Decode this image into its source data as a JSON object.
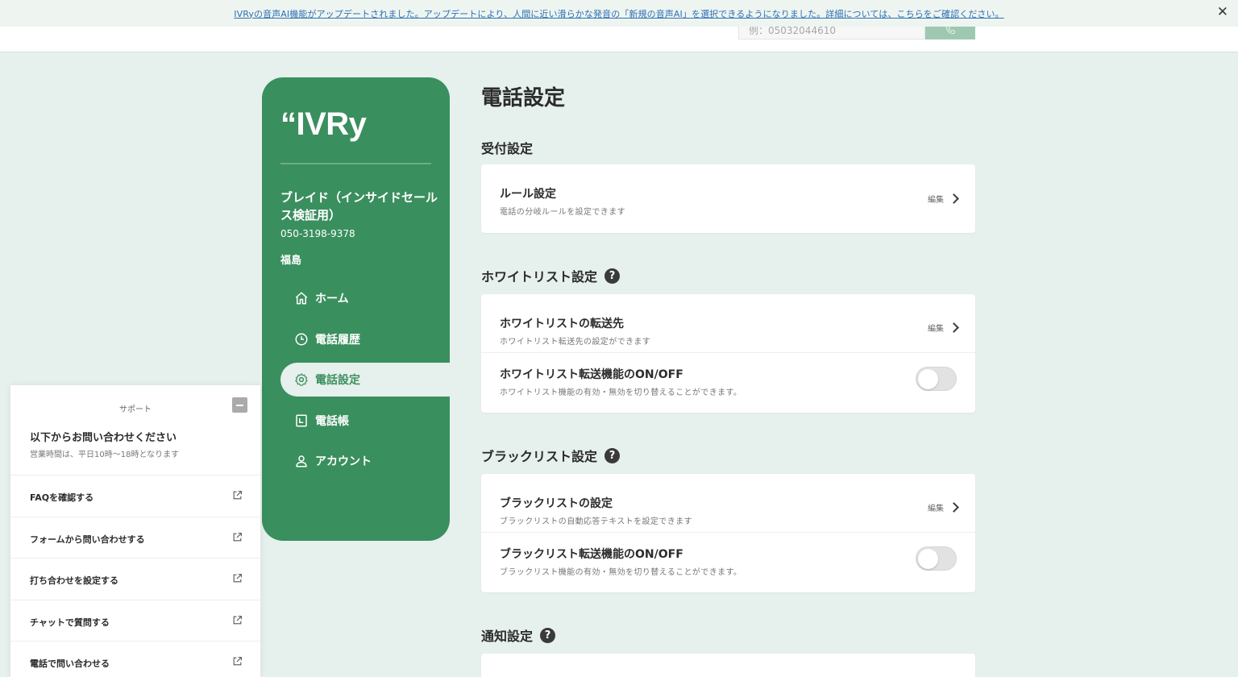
{
  "banner": {
    "text": "IVRyの音声AI機能がアップデートされました。アップデートにより、人間に近い滑らかな発音の「新規の音声AI」を選択できるようになりました。詳細については、こちらをご確認ください。",
    "close": "✕"
  },
  "header": {
    "phone_placeholder": "例：05032044610"
  },
  "sidebar": {
    "logo": "“IVRy",
    "company_name": "ブレイド（インサイドセールス検証用）",
    "company_phone": "050-3198-9378",
    "user_name": "福島",
    "nav": [
      {
        "label": "ホーム",
        "icon": "home-icon"
      },
      {
        "label": "電話履歴",
        "icon": "clock-icon"
      },
      {
        "label": "電話設定",
        "icon": "gear-icon",
        "active": true
      },
      {
        "label": "電話帳",
        "icon": "phonebook-icon"
      },
      {
        "label": "アカウント",
        "icon": "user-icon"
      }
    ]
  },
  "main": {
    "title": "電話設定",
    "sections": {
      "reception": {
        "title": "受付設定",
        "rows": [
          {
            "title": "ルール設定",
            "desc": "電話の分岐ルールを設定できます",
            "action": "編集"
          }
        ]
      },
      "whitelist": {
        "title": "ホワイトリスト設定",
        "help": "?",
        "rows": [
          {
            "title": "ホワイトリストの転送先",
            "desc": "ホワイトリスト転送先の設定ができます",
            "action": "編集"
          },
          {
            "title": "ホワイトリスト転送機能のON/OFF",
            "desc": "ホワイトリスト機能の有効・無効を切り替えることができます。",
            "toggle": false
          }
        ]
      },
      "blacklist": {
        "title": "ブラックリスト設定",
        "help": "?",
        "rows": [
          {
            "title": "ブラックリストの設定",
            "desc": "ブラックリストの自動応答テキストを設定できます",
            "action": "編集"
          },
          {
            "title": "ブラックリスト転送機能のON/OFF",
            "desc": "ブラックリスト機能の有効・無効を切り替えることができます。",
            "toggle": false
          }
        ]
      },
      "notification": {
        "title": "通知設定",
        "help": "?"
      }
    }
  },
  "support": {
    "label": "サポート",
    "heading": "以下からお問い合わせください",
    "hours": "営業時間は、平日10時〜18時となります",
    "items": [
      "FAQを確認する",
      "フォームから問い合わせする",
      "打ち合わせを設定する",
      "チャットで質問する",
      "電話で問い合わせる"
    ]
  },
  "colors": {
    "brand_green": "#3a8f5e",
    "page_bg": "#e6f0ec",
    "link_blue": "#2e6fb3"
  }
}
